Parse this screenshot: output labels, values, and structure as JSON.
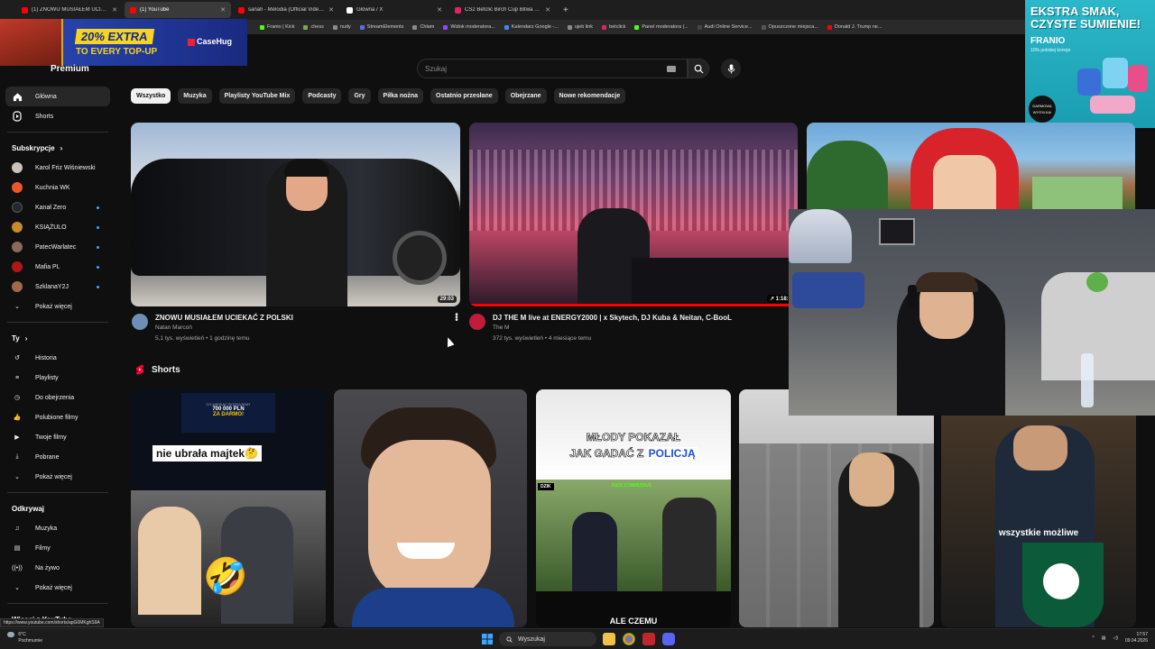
{
  "browser": {
    "tabs": [
      {
        "title": "(1) ZNOWU MUSIAŁEM UCIEKA...",
        "active": false,
        "icon_color": "#ff0000"
      },
      {
        "title": "(1) YouTube",
        "active": true,
        "icon_color": "#ff0000"
      },
      {
        "title": "sanah - Melodia (Official Video...",
        "active": false,
        "icon_color": "#ff0000"
      },
      {
        "title": "Główna / X",
        "active": false,
        "icon_color": "#ffffff"
      },
      {
        "title": "CS2 Betclic Birch Cup Bitwa Stre...",
        "active": false,
        "icon_color": "#e0245e"
      }
    ],
    "bookmarks": [
      "Franio | Kick",
      "chess",
      "nudy",
      "StreamElements",
      "Chłam",
      "Widok moderatora...",
      "Kalendarz Google -...",
      "ujeb link",
      "betclick",
      "Panel moderatora |...",
      "Audi Online Service...",
      "Opuszczone miejsca...",
      "Donald J. Trump ne..."
    ]
  },
  "ads": {
    "left": {
      "line1": "20% EXTRA",
      "line2": "TO EVERY TOP-UP",
      "brand": "CaseHug"
    },
    "right": {
      "line1": "EKSTRA SMAK,",
      "line2": "CZYSTE SUMIENIE!",
      "line3": "FRANIO",
      "line4": "10% polskiej konopi",
      "badge": "DARMOWA WYSYŁKA!"
    }
  },
  "header": {
    "logo_text": "Premium",
    "search_placeholder": "Szukaj"
  },
  "sidebar": {
    "main": [
      {
        "label": "Główna",
        "icon": "home-icon",
        "active": true
      },
      {
        "label": "Shorts",
        "icon": "shorts-icon",
        "active": false
      }
    ],
    "subs_title": "Subskrypcje",
    "subscriptions": [
      {
        "label": "Karol Friz Wiśniewski",
        "color": "#c9c2bd",
        "live": false
      },
      {
        "label": "Kuchnia WK",
        "color": "#e8582a",
        "live": false
      },
      {
        "label": "Kanał Zero",
        "color": "#222831",
        "live": true
      },
      {
        "label": "KSIĄŻULO",
        "color": "#c58b2c",
        "live": true
      },
      {
        "label": "PatecWarlatec",
        "color": "#8a6a5a",
        "live": true
      },
      {
        "label": "Mafia PL",
        "color": "#b01818",
        "live": true
      },
      {
        "label": "SzklanaY2J",
        "color": "#a06a4a",
        "live": true
      }
    ],
    "subs_more": "Pokaż więcej",
    "you_title": "Ty",
    "you_items": [
      {
        "label": "Historia",
        "icon": "history-icon"
      },
      {
        "label": "Playlisty",
        "icon": "playlist-icon"
      },
      {
        "label": "Do obejrzenia",
        "icon": "watch-later-icon"
      },
      {
        "label": "Polubione filmy",
        "icon": "like-icon"
      },
      {
        "label": "Twoje filmy",
        "icon": "your-videos-icon"
      },
      {
        "label": "Pobrane",
        "icon": "download-icon"
      },
      {
        "label": "Pokaż więcej",
        "icon": "chevron-down-icon"
      }
    ],
    "explore_title": "Odkrywaj",
    "explore_items": [
      {
        "label": "Muzyka",
        "icon": "music-icon"
      },
      {
        "label": "Filmy",
        "icon": "movies-icon"
      },
      {
        "label": "Na żywo",
        "icon": "live-icon"
      },
      {
        "label": "Pokaż więcej",
        "icon": "chevron-down-icon"
      }
    ],
    "more_title": "Więcej z YouTube"
  },
  "chips": [
    "Wszystko",
    "Muzyka",
    "Playlisty YouTube Mix",
    "Podcasty",
    "Gry",
    "Piłka nożna",
    "Ostatnio przesłane",
    "Obejrzane",
    "Nowe rekomendacje"
  ],
  "videos": [
    {
      "title": "ZNOWU MUSIAŁEM UCIEKAĆ Z POLSKI",
      "channel": "Natan Marcoń",
      "stats": "5,1 tys. wyświetleń • 1 godzinę temu",
      "duration": "29:03"
    },
    {
      "title": "DJ THE M live at ENERGY2000 | x Skytech, DJ Kuba & Neitan, C-BooL",
      "channel": "The M",
      "stats": "372 tys. wyświetleń • 4 miesiące temu",
      "duration": "1:18:1"
    }
  ],
  "shorts": {
    "title": "Shorts",
    "captions": {
      "s1_top": "CO MIESIĄC ROZDAJEMY",
      "s1_amount": "700 000 PLN",
      "s1_free": "ZA DARMO!",
      "s1_main": "nie ubrała majtek🤔",
      "s3_top1": "MŁODY POKAZAŁ",
      "s3_top2_a": "JAK GADAĆ Z",
      "s3_top2_b": "POLICJĄ",
      "s3_bottom": "ALE CZEMU",
      "s3_tag": "DZIK",
      "s3_site": "KICK.COM/BZDUS",
      "s5_main": "wszystkie możliwe"
    }
  },
  "status_url": "https://www.youtube.com/shorts/apG0MKghS9A",
  "taskbar": {
    "weather_temp": "6°C",
    "weather_desc": "Pochmurnie",
    "search": "Wyszukaj",
    "time": "17:57",
    "date": "09.04.2026"
  }
}
